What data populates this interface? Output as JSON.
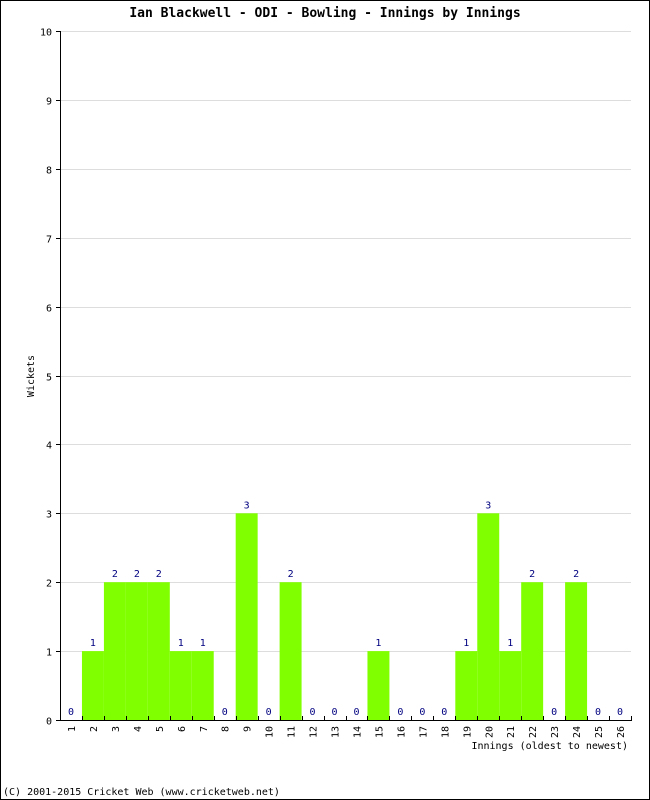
{
  "chart_data": {
    "type": "bar",
    "title": "Ian Blackwell - ODI - Bowling - Innings by Innings",
    "xlabel": "Innings (oldest to newest)",
    "ylabel": "Wickets",
    "ylim": [
      0,
      10
    ],
    "yticks": [
      "0",
      "1",
      "2",
      "3",
      "4",
      "5",
      "6",
      "7",
      "8",
      "9",
      "10"
    ],
    "grid": true,
    "categories": [
      "1",
      "2",
      "3",
      "4",
      "5",
      "6",
      "7",
      "8",
      "9",
      "10",
      "11",
      "12",
      "13",
      "14",
      "15",
      "16",
      "17",
      "18",
      "19",
      "20",
      "21",
      "22",
      "23",
      "24",
      "25",
      "26"
    ],
    "values": [
      0,
      1,
      2,
      2,
      2,
      1,
      1,
      0,
      3,
      0,
      2,
      0,
      0,
      0,
      1,
      0,
      0,
      0,
      1,
      3,
      1,
      2,
      0,
      2,
      0,
      0
    ],
    "bar_color": "#80ff00",
    "label_color": "#000080",
    "grid_color": "#dddddd"
  },
  "footer": "(C) 2001-2015 Cricket Web (www.cricketweb.net)"
}
